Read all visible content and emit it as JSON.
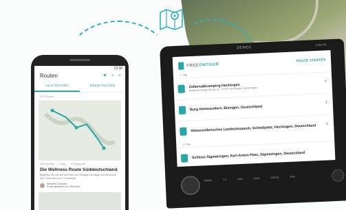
{
  "phone": {
    "status_time": "12:30",
    "title": "Routen",
    "tabs": [
      "ALLE ROUTEN",
      "MEINE ROUTEN"
    ],
    "routes_count": "262 Routen",
    "route_meta": [
      "452 Kilometer",
      "4 Tage",
      "20 Wegpunkte"
    ],
    "route_title": "Die Wellness Route Süddeutschland",
    "route_desc": "Begleiten Sie uns auf der Fahrt von Stuttgart ins Allgäu und besuchen Sie 3 Thermen und 1 Freizeitbad.",
    "author_name": "Manuela Constant",
    "author_meta": "Route geändert vor 4 Wochen"
  },
  "unit": {
    "brand": "ZENEC",
    "model": "Z-E3776",
    "logo_part1": "FREE",
    "logo_part2": "ONTOUR",
    "start_button": "ROUTE STARTEN",
    "day1": "1. Tag",
    "day2": "2. Tag",
    "stops": [
      {
        "name": "Zollernalbcamping Hechingen",
        "addr": "Niederhechinger Straße 41, 72379, Hechingen, Deutschland"
      },
      {
        "name": "Burg Hohenzollern, Bisingen, Deutschland",
        "addr": ""
      },
      {
        "name": "Hohenzollerisches Landesmuseum, Schloßplatz, Hechingen, Deutschland",
        "addr": ""
      },
      {
        "name": "Schloss Sigmaringen, Karl-Anton-Platz, Sigmaringen, Deutschland",
        "addr": ""
      }
    ],
    "buttons": [
      "HOME",
      "TV",
      "NAV",
      "DVD",
      "VOICE",
      "FAV"
    ]
  }
}
